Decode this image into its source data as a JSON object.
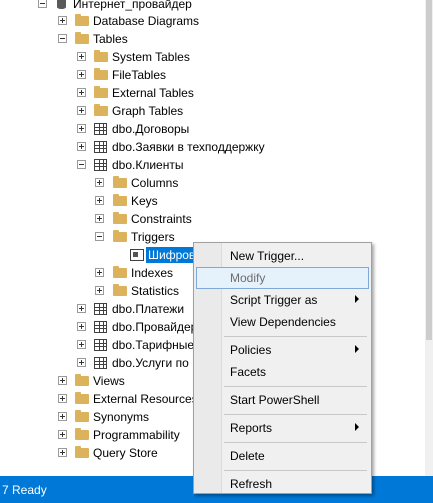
{
  "tree": {
    "db_name": "Интернет_провайдер",
    "database_diagrams": "Database Diagrams",
    "tables": "Tables",
    "system_tables": "System Tables",
    "file_tables": "FileTables",
    "external_tables": "External Tables",
    "graph_tables": "Graph Tables",
    "t_dogovory": "dbo.Договоры",
    "t_zayavki": "dbo.Заявки в техподдержку",
    "t_klienty": "dbo.Клиенты",
    "columns": "Columns",
    "keys": "Keys",
    "constraints": "Constraints",
    "triggers": "Triggers",
    "trigger_item": "Шифров",
    "indexes": "Indexes",
    "statistics": "Statistics",
    "t_platezhi": "dbo.Платежи",
    "t_provaydery": "dbo.Провайдер",
    "t_tarifnye": "dbo.Тарифные",
    "t_uslugi": "dbo.Услуги по",
    "views": "Views",
    "external_resources": "External Resources",
    "synonyms": "Synonyms",
    "programmability": "Programmability",
    "query_store": "Query Store"
  },
  "context_menu": {
    "new_trigger": "New Trigger...",
    "modify": "Modify",
    "script_trigger_as": "Script Trigger as",
    "view_dependencies": "View Dependencies",
    "policies": "Policies",
    "facets": "Facets",
    "start_powershell": "Start PowerShell",
    "reports": "Reports",
    "delete": "Delete",
    "refresh": "Refresh"
  },
  "status": {
    "text": "Ready",
    "left_glyph": "7"
  },
  "colors": {
    "accent": "#0078d7",
    "folder": "#dcb35c",
    "menu_bg": "#f0f0f0"
  }
}
